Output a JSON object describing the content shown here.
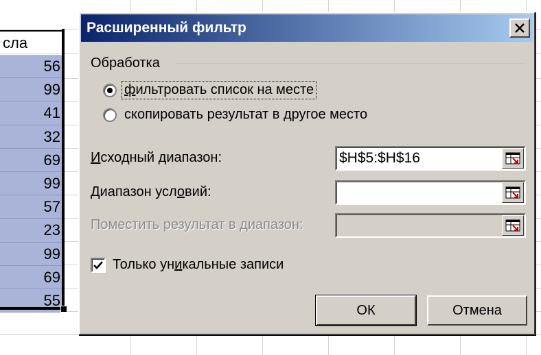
{
  "spreadsheet": {
    "header_fragment": "сла",
    "values": [
      "56",
      "99",
      "41",
      "32",
      "69",
      "99",
      "57",
      "23",
      "99",
      "69",
      "55"
    ]
  },
  "dialog": {
    "title": "Расширенный фильтр",
    "close_label": "×",
    "group_label": "Обработка",
    "radio_filter_in_place": {
      "pre": "",
      "mnemonic": "ф",
      "post": "ильтровать список на месте",
      "selected": true
    },
    "radio_copy_to_location": {
      "pre": "скопировать результат в ",
      "mnemonic": "д",
      "post": "ругое место",
      "selected": false
    },
    "source_range": {
      "pre": "",
      "mnemonic": "И",
      "post": "сходный диапазон:",
      "value": "$H$5:$H$16"
    },
    "criteria_range": {
      "pre": "Диапазон усл",
      "mnemonic": "о",
      "post": "вий:",
      "value": ""
    },
    "copy_to_range": {
      "label": "Поместить результат в диапазон:",
      "value": "",
      "disabled": true
    },
    "unique_checkbox": {
      "pre": "Только ун",
      "mnemonic": "и",
      "post": "кальные записи",
      "checked": true
    },
    "ok_label": "ОК",
    "cancel_label": "Отмена"
  },
  "colors": {
    "titlebar_start": "#0a246a",
    "titlebar_end": "#a6caf0",
    "dialog_face": "#d4d0c8",
    "selection_fill": "#aab4d8"
  },
  "icons": {
    "ref_button": "collapse-dialog-icon",
    "checkbox": "checkmark-icon",
    "close": "close-icon"
  }
}
